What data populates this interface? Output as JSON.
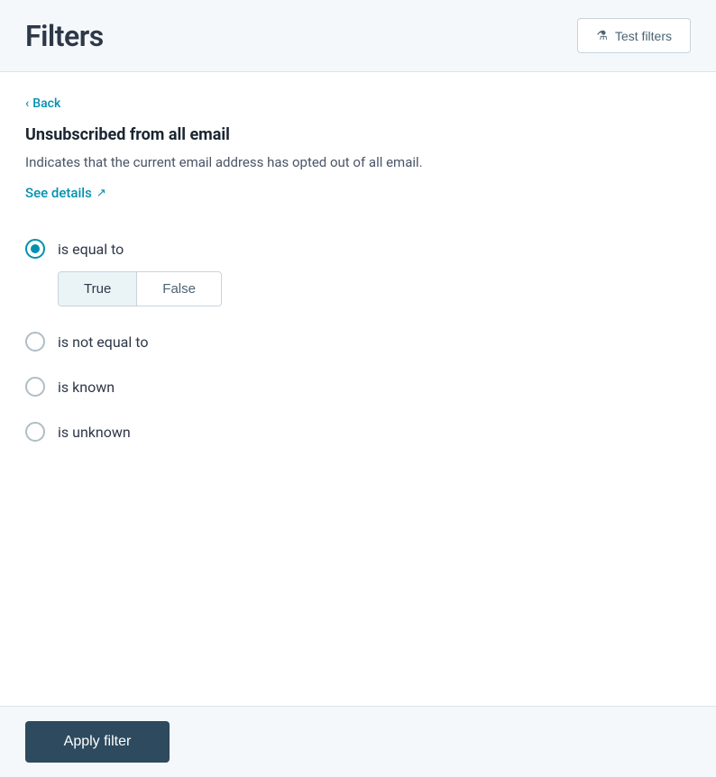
{
  "header": {
    "title": "Filters",
    "test_filters_label": "Test filters"
  },
  "back": {
    "label": "Back"
  },
  "filter": {
    "title": "Unsubscribed from all email",
    "description": "Indicates that the current email address has opted out of all email.",
    "see_details_label": "See details"
  },
  "options": [
    {
      "id": "is_equal_to",
      "label": "is equal to",
      "selected": true,
      "has_toggle": true
    },
    {
      "id": "is_not_equal_to",
      "label": "is not equal to",
      "selected": false,
      "has_toggle": false
    },
    {
      "id": "is_known",
      "label": "is known",
      "selected": false,
      "has_toggle": false
    },
    {
      "id": "is_unknown",
      "label": "is unknown",
      "selected": false,
      "has_toggle": false
    }
  ],
  "toggle": {
    "true_label": "True",
    "false_label": "False",
    "active": "true"
  },
  "apply_filter": {
    "label": "Apply filter"
  }
}
